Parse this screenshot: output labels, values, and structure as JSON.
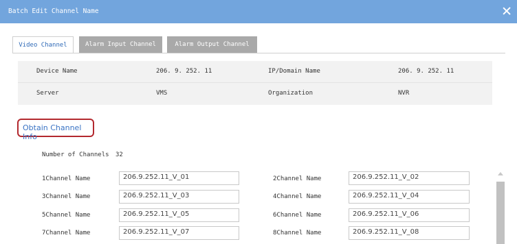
{
  "window": {
    "title": "Batch Edit Channel Name"
  },
  "tabs": [
    {
      "label": "Video Channel",
      "active": true
    },
    {
      "label": "Alarm Input Channel",
      "active": false
    },
    {
      "label": "Alarm Output Channel",
      "active": false
    }
  ],
  "device_info": {
    "device_name_label": "Device Name",
    "device_name_value": "206. 9. 252. 11",
    "ip_label": "IP/Domain Name",
    "ip_value": "206. 9. 252. 11",
    "server_label": "Server",
    "server_value": "VMS",
    "org_label": "Organization",
    "org_value": "NVR"
  },
  "obtain_button": {
    "label": "Obtain Channel Info"
  },
  "channels_count": {
    "label": "Number of Channels",
    "value": "32"
  },
  "channels": [
    {
      "label": "1Channel Name",
      "value": "206.9.252.11_V_01"
    },
    {
      "label": "2Channel Name",
      "value": "206.9.252.11_V_02"
    },
    {
      "label": "3Channel Name",
      "value": "206.9.252.11_V_03"
    },
    {
      "label": "4Channel Name",
      "value": "206.9.252.11_V_04"
    },
    {
      "label": "5Channel Name",
      "value": "206.9.252.11_V_05"
    },
    {
      "label": "6Channel Name",
      "value": "206.9.252.11_V_06"
    },
    {
      "label": "7Channel Name",
      "value": "206.9.252.11_V_07"
    },
    {
      "label": "8Channel Name",
      "value": "206.9.252.11_V_08"
    }
  ],
  "colors": {
    "titlebar": "#72a5dd",
    "active_tab_text": "#2f6ab7",
    "highlight_border": "#b3282e",
    "link_blue": "#3a73c4"
  },
  "icons": {
    "close": "close-icon",
    "scroll_up": "chevron-up-icon"
  }
}
